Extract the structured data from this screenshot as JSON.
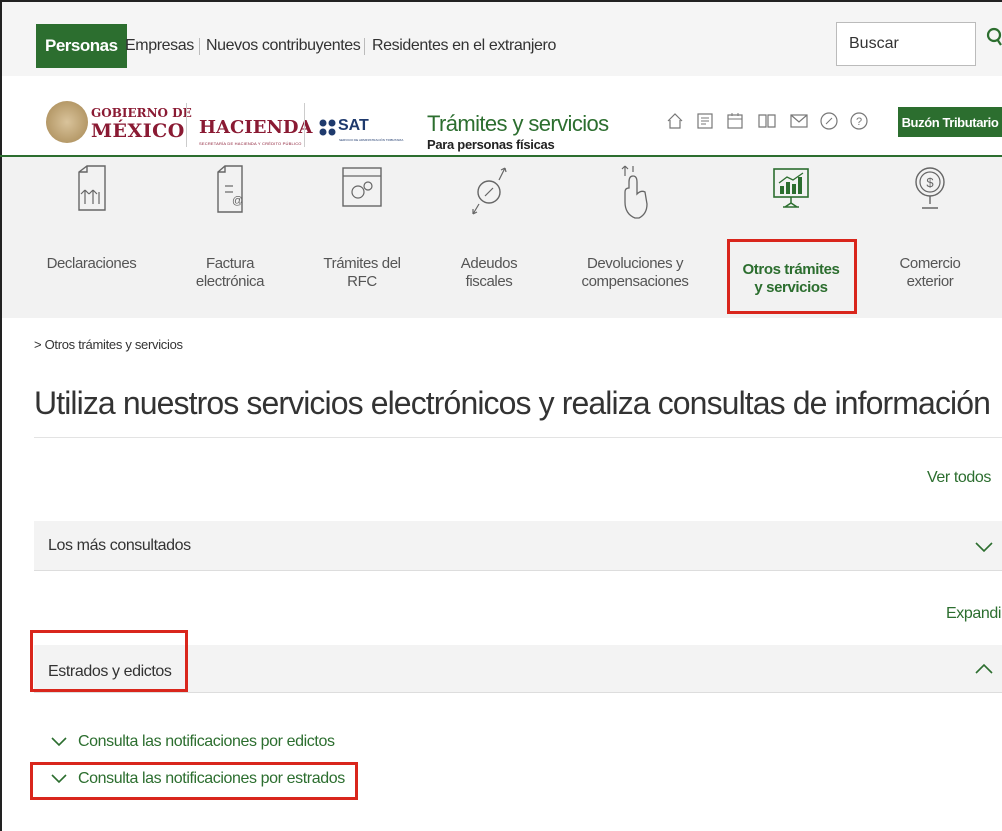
{
  "topnav": {
    "active_tab": "Personas",
    "links": [
      "Empresas",
      "Nuevos contribuyentes",
      "Residentes en el extranjero"
    ],
    "search_placeholder": "Buscar",
    "search_icon": "search-icon"
  },
  "header": {
    "gob_line1": "GOBIERNO DE",
    "gob_line2": "MÉXICO",
    "hacienda": "HACIENDA",
    "hacienda_sub": "SECRETARÍA DE HACIENDA Y CRÉDITO PÚBLICO",
    "sat": "SAT",
    "sat_sub": "SERVICIO DE ADMINISTRACIÓN TRIBUTARIA",
    "site_title": "Trámites y servicios",
    "site_subtitle": "Para personas físicas",
    "icons": [
      "home-icon",
      "document-icon",
      "calendar-icon",
      "book-icon",
      "mail-icon",
      "compass-icon",
      "help-icon"
    ],
    "buzon": "Buzón Tributario"
  },
  "categories": [
    {
      "line1": "Declaraciones",
      "line2": "",
      "icon": "declaraciones-icon"
    },
    {
      "line1": "Factura",
      "line2": "electrónica",
      "icon": "factura-icon"
    },
    {
      "line1": "Trámites del",
      "line2": "RFC",
      "icon": "rfc-icon"
    },
    {
      "line1": "Adeudos",
      "line2": "fiscales",
      "icon": "adeudos-icon"
    },
    {
      "line1": "Devoluciones y",
      "line2": "compensaciones",
      "icon": "devoluciones-icon"
    },
    {
      "line1": "Otros trámites",
      "line2": "y servicios",
      "icon": "otros-tramites-icon",
      "active": true
    },
    {
      "line1": "Comercio",
      "line2": "exterior",
      "icon": "comercio-icon"
    }
  ],
  "breadcrumb": "> Otros trámites y servicios",
  "page_title": "Utiliza nuestros servicios electrónicos y realiza consultas de información",
  "ver_todos": "Ver todos",
  "section1": {
    "label": "Los más consultados"
  },
  "expandir": "Expandir",
  "section2": {
    "label": "Estrados y edictos"
  },
  "sublinks": [
    "Consulta las notificaciones por edictos",
    "Consulta las notificaciones por estrados"
  ],
  "colors": {
    "brand_green": "#2c6e2f",
    "highlight_red": "#d9261c",
    "gob_maroon": "#8a1a33"
  }
}
